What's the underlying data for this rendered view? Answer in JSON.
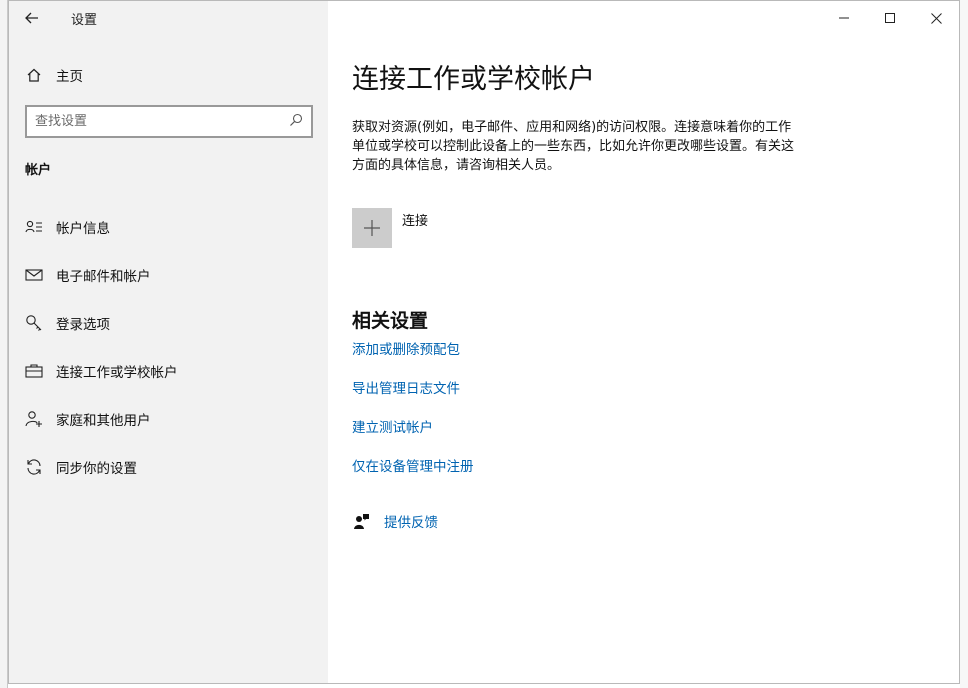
{
  "window": {
    "title": "设置",
    "minimize_icon": "minimize-icon",
    "maximize_icon": "maximize-icon",
    "close_icon": "close-icon"
  },
  "sidebar": {
    "home_label": "主页",
    "search_placeholder": "查找设置",
    "section_title": "帐户",
    "items": [
      {
        "label": "帐户信息",
        "icon": "account-info-icon"
      },
      {
        "label": "电子邮件和帐户",
        "icon": "email-icon"
      },
      {
        "label": "登录选项",
        "icon": "key-icon"
      },
      {
        "label": "连接工作或学校帐户",
        "icon": "briefcase-icon"
      },
      {
        "label": "家庭和其他用户",
        "icon": "add-user-icon"
      },
      {
        "label": "同步你的设置",
        "icon": "sync-icon"
      }
    ]
  },
  "main": {
    "title": "连接工作或学校帐户",
    "description": "获取对资源(例如，电子邮件、应用和网络)的访问权限。连接意味着你的工作单位或学校可以控制此设备上的一些东西，比如允许你更改哪些设置。有关这方面的具体信息，请咨询相关人员。",
    "connect_label": "连接",
    "related_title": "相关设置",
    "related_links": [
      "添加或删除预配包",
      "导出管理日志文件",
      "建立测试帐户",
      "仅在设备管理中注册"
    ],
    "feedback_label": "提供反馈"
  },
  "colors": {
    "link": "#0063b1",
    "sidebar_bg": "#f2f2f2",
    "plus_tile": "#cccccc"
  }
}
